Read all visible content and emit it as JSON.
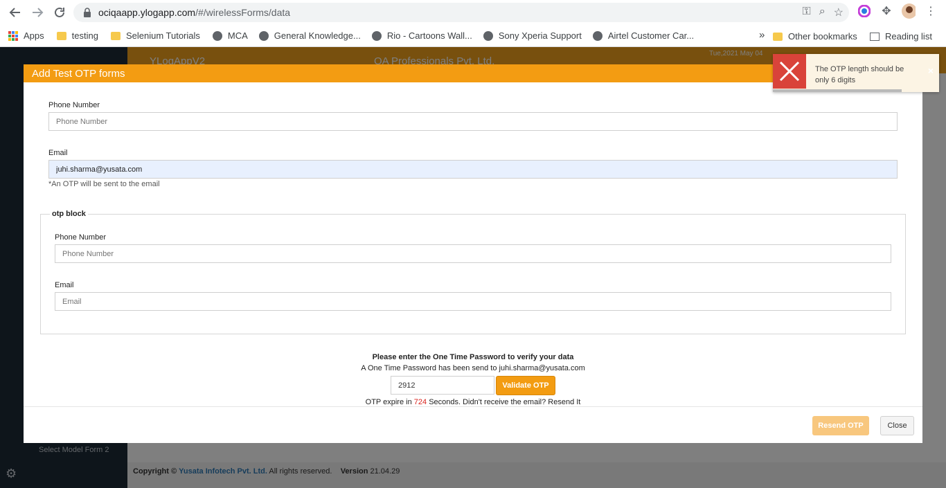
{
  "browser": {
    "url_host": "ociqaapp.ylogapp.com",
    "url_path": "/#/wirelessForms/data",
    "bookmarks": [
      {
        "label": "Apps",
        "type": "apps"
      },
      {
        "label": "testing",
        "type": "folder"
      },
      {
        "label": "Selenium Tutorials",
        "type": "folder"
      },
      {
        "label": "MCA",
        "type": "globe"
      },
      {
        "label": "General Knowledge...",
        "type": "globe"
      },
      {
        "label": "Rio - Cartoons Wall...",
        "type": "globe"
      },
      {
        "label": "Sony Xperia Support",
        "type": "globe"
      },
      {
        "label": "Airtel Customer Car...",
        "type": "globe"
      }
    ],
    "more_bookmarks": "»",
    "other_bookmarks": "Other bookmarks",
    "reading_list": "Reading list"
  },
  "app": {
    "header_left": "YLogAppV2",
    "header_center": "QA Professionals Pvt. Ltd.",
    "header_date": "Tue,2021 May 04",
    "sidebar_item": "Select Model Form 2",
    "footer": {
      "copyright_prefix": "Copyright ©",
      "company": "Yusata Infotech Pvt. Ltd.",
      "rights": "All rights reserved.",
      "version_label": "Version",
      "version_value": "21.04.29"
    }
  },
  "modal": {
    "title": "Add Test OTP forms",
    "phone_label": "Phone Number",
    "phone_placeholder": "Phone Number",
    "email_label": "Email",
    "email_value": "juhi.sharma@yusata.com",
    "email_note": "*An OTP will be sent to the email",
    "otp_block": {
      "legend": "otp block",
      "phone_label": "Phone Number",
      "phone_placeholder": "Phone Number",
      "email_label": "Email",
      "email_placeholder": "Email"
    },
    "verify_heading": "Please enter the One Time Password to verify your data",
    "sent_text": "A One Time Password has been send to juhi.sharma@yusata.com",
    "otp_value": "2912",
    "validate_label": "Validate OTP",
    "expire_prefix": "OTP expire in",
    "expire_seconds": "724",
    "expire_suffix": "Seconds. Didn't receive the email? Resend It",
    "resend_label": "Resend OTP",
    "close_label": "Close"
  },
  "toast": {
    "message": "The OTP length should be only 6 digits",
    "close_glyph": "×"
  },
  "colors": {
    "accent": "#f39c12",
    "error": "#d9433a"
  }
}
